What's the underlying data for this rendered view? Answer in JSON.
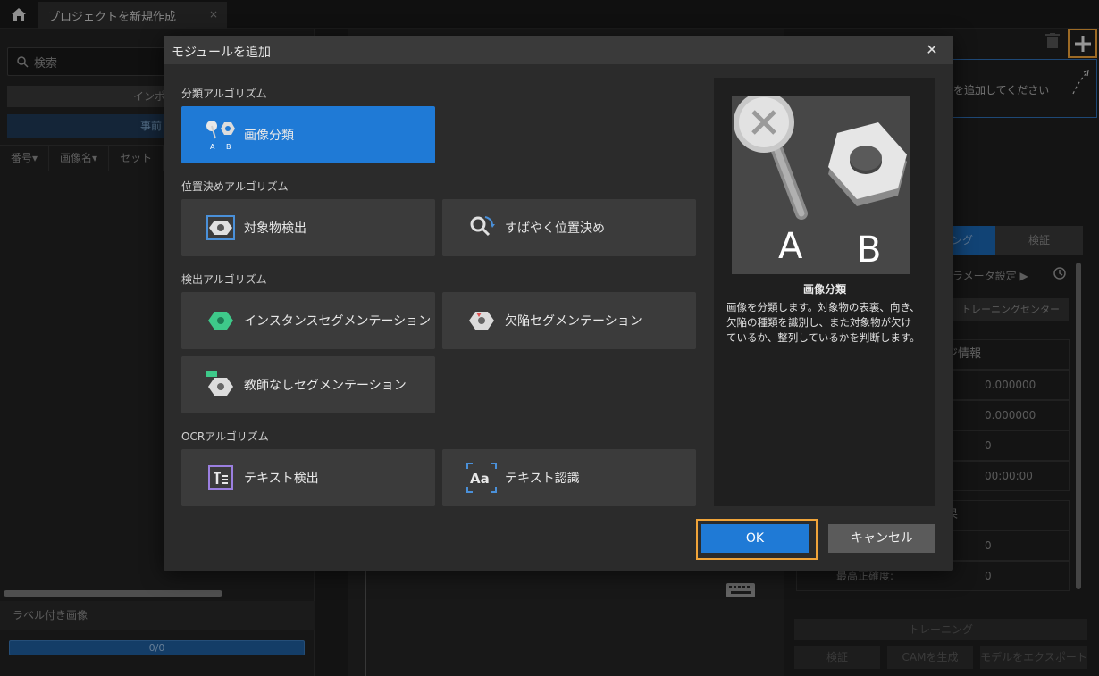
{
  "app": {
    "tab_title": "プロジェクトを新規作成",
    "tab_close": "×",
    "search_placeholder": "検索",
    "import_button": "インポート/エク",
    "pretrain_button": "事前トレーニ",
    "columns": [
      "番号▾",
      "画像名▾",
      "セット"
    ],
    "labeled_images": "ラベル付き画像",
    "progress_text": "0/0",
    "hint_text": "を追加してください",
    "right_tabs": [
      "ング",
      "検証"
    ],
    "params_label": "ラメータ設定 ▶",
    "training_center": "トレーニングセンター",
    "info_header": "ジ情報",
    "info_values": [
      "0.000000",
      "0.000000",
      "0",
      "00:00:00"
    ],
    "best_header": "果",
    "best_values": [
      "0",
      "0"
    ],
    "best_accuracy_label": "最高正確度:",
    "train_button": "トレーニング",
    "verify_button": "検証",
    "cam_button": "CAMを生成",
    "export_button": "モデルをエクスポート"
  },
  "dialog": {
    "title": "モジュールを追加",
    "close": "✕",
    "sections": [
      {
        "title": "分類アルゴリズム",
        "modules": [
          {
            "label": "画像分類",
            "icon": "classification-icon",
            "selected": true
          }
        ]
      },
      {
        "title": "位置決めアルゴリズム",
        "modules": [
          {
            "label": "対象物検出",
            "icon": "object-detection-icon"
          },
          {
            "label": "すばやく位置決め",
            "icon": "fast-positioning-icon"
          }
        ]
      },
      {
        "title": "検出アルゴリズム",
        "modules": [
          {
            "label": "インスタンスセグメンテーション",
            "icon": "instance-seg-icon"
          },
          {
            "label": "欠陥セグメンテーション",
            "icon": "defect-seg-icon"
          },
          {
            "label": "教師なしセグメンテーション",
            "icon": "unsupervised-seg-icon"
          }
        ]
      },
      {
        "title": "OCRアルゴリズム",
        "modules": [
          {
            "label": "テキスト検出",
            "icon": "text-detection-icon"
          },
          {
            "label": "テキスト認識",
            "icon": "text-recognition-icon"
          }
        ]
      }
    ],
    "preview": {
      "label_a": "A",
      "label_b": "B",
      "title": "画像分類",
      "description": "画像を分類します。対象物の表裏、向き、欠陥の種類を識別し、また対象物が欠けているか、整列しているかを判断します。"
    },
    "ok": "OK",
    "cancel": "キャンセル",
    "colors": {
      "accent": "#1f7ad6",
      "highlight": "#f0a43a"
    }
  }
}
